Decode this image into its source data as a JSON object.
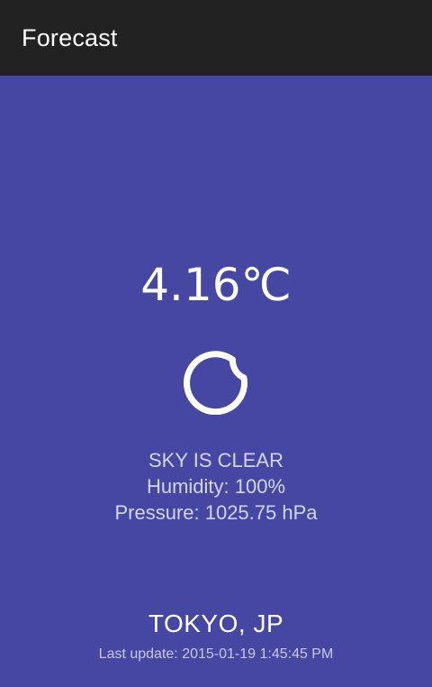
{
  "app_bar": {
    "title": "Forecast"
  },
  "weather": {
    "temperature": "4.16℃",
    "icon": "moon-icon",
    "description": "SKY IS CLEAR",
    "humidity": "Humidity: 100%",
    "pressure": "Pressure: 1025.75 hPa"
  },
  "location": {
    "city": "TOKYO, JP",
    "last_update": "Last update: 2015-01-19 1:45:45 PM"
  },
  "colors": {
    "app_bar_background": "#222222",
    "page_background": "#4547A2",
    "primary_text": "#FFFFFF",
    "secondary_text": "#D4D5EF"
  }
}
